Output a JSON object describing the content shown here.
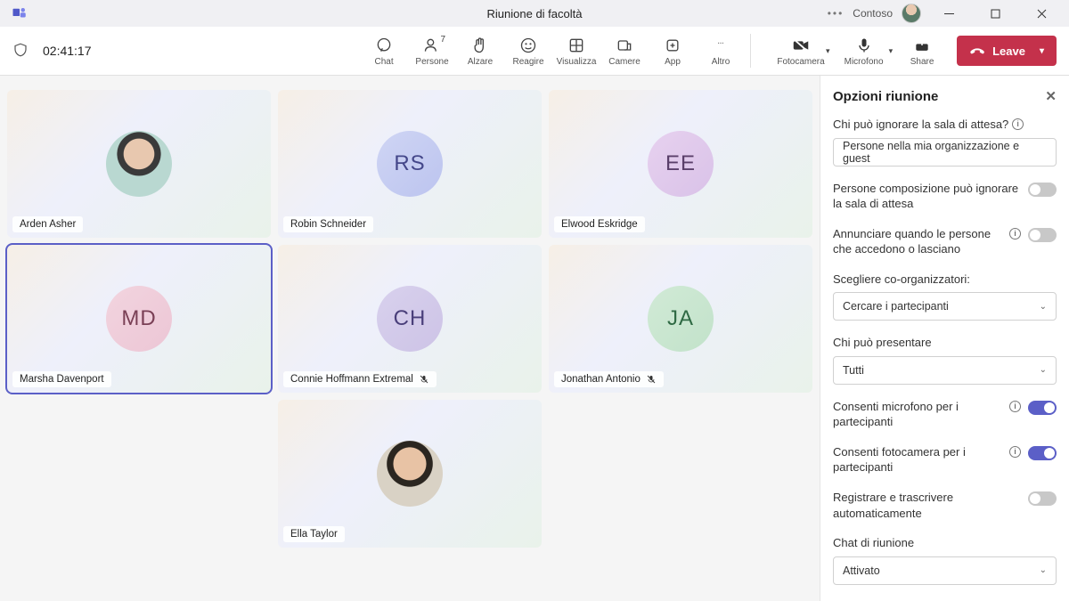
{
  "titlebar": {
    "title": "Riunione di facoltà",
    "org": "Contoso"
  },
  "toolbar": {
    "timer": "02:41:17",
    "buttons": {
      "chat": "Chat",
      "people": "Persone",
      "people_count": "7",
      "raise": "Alzare",
      "react": "Reagire",
      "view": "Visualizza",
      "rooms": "Camere",
      "apps": "App",
      "more": "Altro",
      "camera": "Fotocamera",
      "mic": "Microfono",
      "share": "Share",
      "leave": "Leave"
    }
  },
  "participants": [
    {
      "name": "Arden Asher",
      "initials": "",
      "photo": "photo1",
      "row": 1,
      "col": 1,
      "muted": false,
      "selected": false
    },
    {
      "name": "Robin Schneider",
      "initials": "RS",
      "avc": "av-rs",
      "row": 1,
      "col": 2,
      "muted": false,
      "selected": false
    },
    {
      "name": "Elwood Eskridge",
      "initials": "EE",
      "avc": "av-ee",
      "row": 1,
      "col": 3,
      "muted": false,
      "selected": false
    },
    {
      "name": "Marsha Davenport",
      "initials": "MD",
      "avc": "av-md",
      "row": 2,
      "col": 1,
      "muted": false,
      "selected": true
    },
    {
      "name": "Connie Hoffmann Extremal",
      "initials": "CH",
      "avc": "av-ch",
      "row": 2,
      "col": 2,
      "muted": true,
      "selected": false
    },
    {
      "name": "Jonathan Antonio",
      "initials": "JA",
      "avc": "av-ja",
      "row": 2,
      "col": 3,
      "muted": true,
      "selected": false
    },
    {
      "name": "Ella Taylor",
      "initials": "",
      "photo": "photo2",
      "row": 3,
      "col": 2,
      "muted": false,
      "selected": false
    }
  ],
  "panel": {
    "title": "Opzioni riunione",
    "lobby_q": "Chi può ignorare la sala di attesa?",
    "lobby_value": "Persone nella mia organizzazione e guest",
    "dialin_bypass": "Persone composizione può ignorare la sala di attesa",
    "announce": "Annunciare quando le persone che accedono o lasciano",
    "coorg_label": "Scegliere co-organizzatori:",
    "coorg_value": "Cercare i partecipanti",
    "present_label": "Chi può presentare",
    "present_value": "Tutti",
    "allow_mic": "Consenti microfono per i partecipanti",
    "allow_cam": "Consenti fotocamera per i partecipanti",
    "record": "Registrare e trascrivere automaticamente",
    "chat_label": "Chat di riunione",
    "chat_value": "Attivato"
  }
}
